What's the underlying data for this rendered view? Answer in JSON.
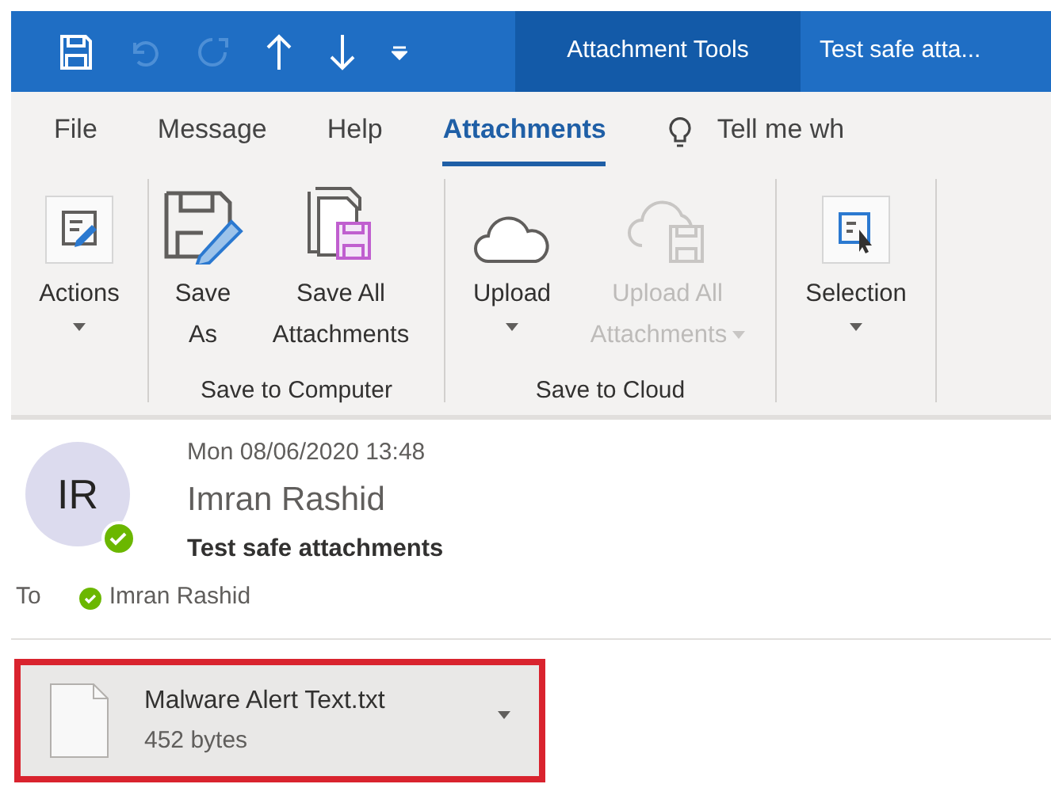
{
  "title_bar": {
    "contextual_tab": "Attachment Tools",
    "title": "Test safe atta..."
  },
  "tabs": [
    {
      "label": "File",
      "selected": false
    },
    {
      "label": "Message",
      "selected": false
    },
    {
      "label": "Help",
      "selected": false
    },
    {
      "label": "Attachments",
      "selected": true
    }
  ],
  "tell_me": "Tell me wh",
  "ribbon_groups": [
    {
      "buttons": [
        {
          "kind": "actions",
          "label": "Actions",
          "dropdown": true,
          "disabled": false
        }
      ]
    },
    {
      "label": "Save to Computer",
      "buttons": [
        {
          "kind": "save-as",
          "label": "Save As",
          "dropdown": false,
          "disabled": false
        },
        {
          "kind": "save-all",
          "label": "Save All Attachments",
          "dropdown": false,
          "disabled": false
        }
      ]
    },
    {
      "label": "Save to Cloud",
      "buttons": [
        {
          "kind": "upload",
          "label": "Upload",
          "dropdown": true,
          "disabled": false
        },
        {
          "kind": "upload-all",
          "label": "Upload All Attachments",
          "dropdown": true,
          "disabled": true
        }
      ]
    },
    {
      "buttons": [
        {
          "kind": "selection",
          "label": "Selection",
          "dropdown": true,
          "disabled": false
        }
      ]
    }
  ],
  "message": {
    "date": "Mon 08/06/2020 13:48",
    "initials": "IR",
    "sender": "Imran Rashid",
    "sender_online": true,
    "subject": "Test safe attachments",
    "to_label": "To",
    "recipients": [
      {
        "name": "Imran Rashid",
        "online": true
      }
    ]
  },
  "attachments": [
    {
      "name": "Malware Alert Text.txt",
      "size": "452 bytes",
      "highlighted": true
    }
  ]
}
